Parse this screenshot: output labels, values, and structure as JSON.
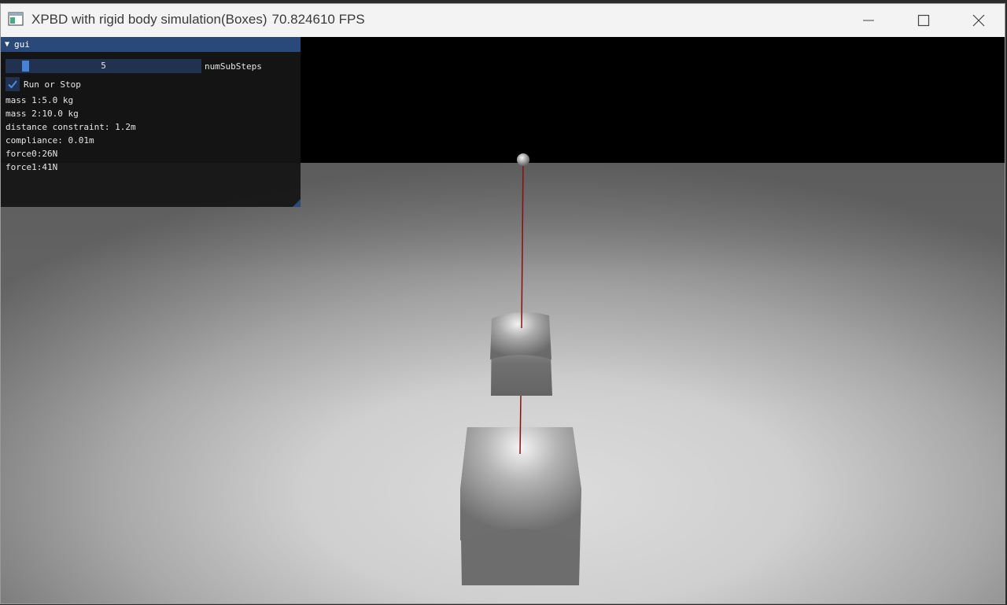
{
  "window": {
    "title": "XPBD with rigid body simulation(Boxes)",
    "fps": "70.824610 FPS"
  },
  "gui": {
    "header": "gui",
    "slider": {
      "value": "5",
      "label": "numSubSteps",
      "level": 0.1
    },
    "checkbox": {
      "label": "Run or Stop",
      "checked": true
    },
    "info": [
      "mass 1:5.0 kg",
      "mass 2:10.0 kg",
      "distance constraint: 1.2m",
      "compliance: 0.01m",
      "force0:26N",
      "force1:41N"
    ]
  },
  "colors": {
    "gui_header": "#29497a",
    "slider_bg": "#20324f",
    "slider_grab": "#4682d6",
    "constraint_line": "#8b0f0f"
  }
}
